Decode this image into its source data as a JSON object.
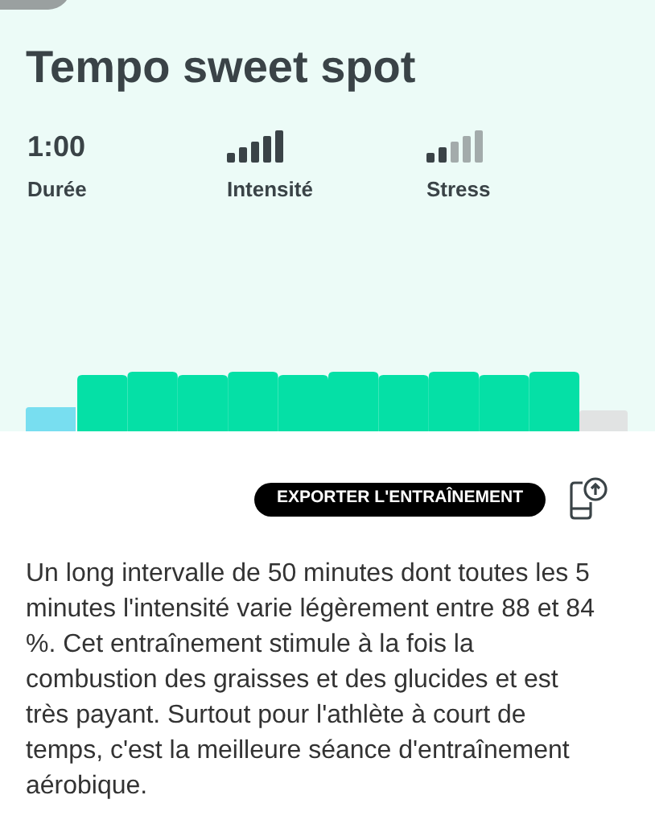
{
  "title": "Tempo sweet spot",
  "stats": [
    {
      "kind": "text",
      "value": "1:00",
      "label": "Durée"
    },
    {
      "kind": "bars",
      "bars": [
        {
          "on": true
        },
        {
          "on": true
        },
        {
          "on": true
        },
        {
          "on": true
        },
        {
          "on": true
        }
      ],
      "label": "Intensité"
    },
    {
      "kind": "bars",
      "bars": [
        {
          "on": true
        },
        {
          "on": true
        },
        {
          "on": false
        },
        {
          "on": false
        },
        {
          "on": false
        }
      ],
      "label": "Stress"
    }
  ],
  "export_button": "EXPORTER L'ENTRAÎNEMENT",
  "description": "Un long intervalle de 50 minutes dont toutes les 5 minutes l'intensité varie légèrement entre 88 et 84 %. Cet entraînement stimule à la fois la combustion des graisses et des glucides et est très payant. Surtout pour l'athlète à court de temps, c'est la meilleure séance d'entraînement aérobique."
}
